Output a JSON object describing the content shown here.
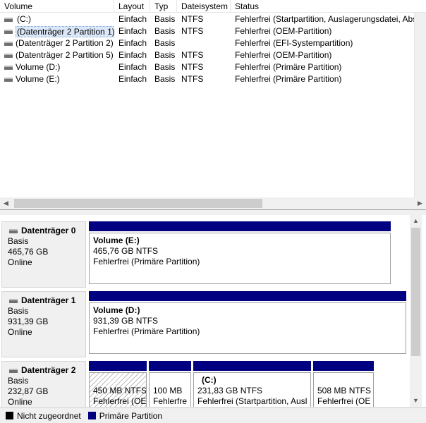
{
  "columns": {
    "volume": "Volume",
    "layout": "Layout",
    "typ": "Typ",
    "dateisystem": "Dateisystem",
    "status": "Status"
  },
  "volumes": [
    {
      "name": "(C:)",
      "layout": "Einfach",
      "typ": "Basis",
      "fs": "NTFS",
      "status": "Fehlerfrei (Startpartition, Auslagerungsdatei, Absturzabbild, Primäre Partition)"
    },
    {
      "name": "(Datenträger 2 Partition 1)",
      "layout": "Einfach",
      "typ": "Basis",
      "fs": "NTFS",
      "status": "Fehlerfrei (OEM-Partition)"
    },
    {
      "name": "(Datenträger 2 Partition 2)",
      "layout": "Einfach",
      "typ": "Basis",
      "fs": "",
      "status": "Fehlerfrei (EFI-Systempartition)"
    },
    {
      "name": "(Datenträger 2 Partition 5)",
      "layout": "Einfach",
      "typ": "Basis",
      "fs": "NTFS",
      "status": "Fehlerfrei (OEM-Partition)"
    },
    {
      "name": "Volume (D:)",
      "layout": "Einfach",
      "typ": "Basis",
      "fs": "NTFS",
      "status": "Fehlerfrei (Primäre Partition)"
    },
    {
      "name": "Volume (E:)",
      "layout": "Einfach",
      "typ": "Basis",
      "fs": "NTFS",
      "status": "Fehlerfrei (Primäre Partition)"
    }
  ],
  "disks": [
    {
      "title": "Datenträger 0",
      "type": "Basis",
      "size": "465,76 GB",
      "state": "Online",
      "partitions": [
        {
          "name": "Volume  (E:)",
          "size": "465,76 GB NTFS",
          "status": "Fehlerfrei (Primäre Partition)"
        }
      ]
    },
    {
      "title": "Datenträger 1",
      "type": "Basis",
      "size": "931,39 GB",
      "state": "Online",
      "partitions": [
        {
          "name": "Volume  (D:)",
          "size": "931,39 GB NTFS",
          "status": "Fehlerfrei (Primäre Partition)"
        }
      ]
    },
    {
      "title": "Datenträger 2",
      "type": "Basis",
      "size": "232,87 GB",
      "state": "Online",
      "partitions": [
        {
          "name": "",
          "size": "450 MB NTFS",
          "status": "Fehlerfrei (OE"
        },
        {
          "name": "",
          "size": "100 MB",
          "status": "Fehlerfre"
        },
        {
          "name": "(C:)",
          "size": "231,83 GB NTFS",
          "status": "Fehlerfrei (Startpartition, Ausl"
        },
        {
          "name": "",
          "size": "508 MB NTFS",
          "status": "Fehlerfrei (OE"
        }
      ]
    }
  ],
  "legend": [
    {
      "label": "Nicht zugeordnet",
      "color": "#000000"
    },
    {
      "label": "Primäre Partition",
      "color": "#000080"
    }
  ],
  "colors": {
    "primary_partition": "#000080",
    "unallocated": "#000000",
    "selection": "#dbe8f8"
  }
}
